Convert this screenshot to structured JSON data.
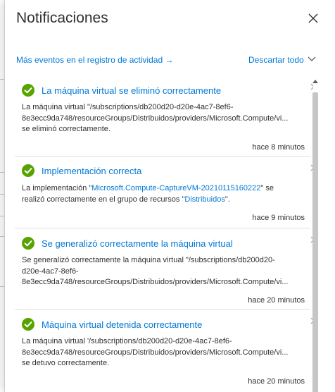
{
  "panel": {
    "title": "Notificaciones",
    "activity_link": "Más eventos en el registro de actividad →",
    "dismiss_all": "Descartar todo"
  },
  "notifications": [
    {
      "title": "La máquina virtual se eliminó correctamente",
      "line1": "La máquina virtual \"/subscriptions/db200d20-d20e-4ac7-8ef6-",
      "line2": "8e3ecc9da748/resourceGroups/Distribuidos/providers/Microsoft.Compute/vi...",
      "line3": "se eliminó correctamente.",
      "time": "hace 8 minutos"
    },
    {
      "title": "Implementación correcta",
      "part1": "La implementación \"",
      "link1": "Microsoft.Compute-CaptureVM-20210115160222",
      "part2": "\" se",
      "part3": "realizó correctamente en el grupo de recursos \"",
      "link2": "Distribuidos",
      "part4": "\".",
      "time": "hace 9 minutos"
    },
    {
      "title": "Se generalizó correctamente la máquina virtual",
      "line1": "Se generalizó correctamente la máquina virtual \"/subscriptions/db200d20-",
      "line2": "d20e-4ac7-8ef6-",
      "line3": "8e3ecc9da748/resourceGroups/Distribuidos/providers/Microsoft.Compute/vi...",
      "time": "hace 20 minutos"
    },
    {
      "title": "Máquina virtual detenida correctamente",
      "line1": "La máquina virtual '/subscriptions/db200d20-d20e-4ac7-8ef6-",
      "line2": "8e3ecc9da748/resourceGroups/Distribuidos/providers/Microsoft.Compute/vi...",
      "line3": "se detuvo correctamente.",
      "time": "hace 20 minutos"
    }
  ],
  "colors": {
    "accent": "#0078d4",
    "success": "#57a300",
    "text": "#323130"
  },
  "icons": {
    "close": "close-icon",
    "success": "check-circle-icon",
    "dismiss": "dismiss-icon",
    "expand": "chevron-down-icon"
  }
}
